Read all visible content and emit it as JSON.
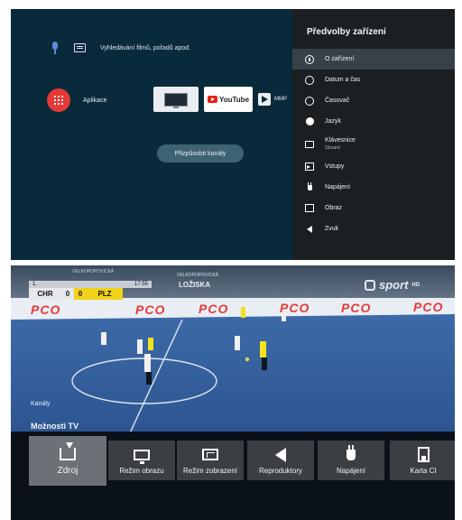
{
  "home": {
    "search_text": "Vyhledávání filmů, pořadů apod.",
    "apps_label": "Aplikace",
    "youtube_label": "YouTube",
    "mmp_label": "MMP",
    "customize_button": "Přizpůsobit kanály"
  },
  "device_prefs": {
    "title": "Předvolby zařízení",
    "items": [
      {
        "label": "O zařízení",
        "sub": "",
        "icon": "info-icon"
      },
      {
        "label": "Datum a čas",
        "sub": "",
        "icon": "clock-icon"
      },
      {
        "label": "Časovač",
        "sub": "",
        "icon": "timer-icon"
      },
      {
        "label": "Jazyk",
        "sub": "",
        "icon": "globe-icon"
      },
      {
        "label": "Klávesnice",
        "sub": "Gboard",
        "icon": "keyboard-icon"
      },
      {
        "label": "Vstupy",
        "sub": "",
        "icon": "input-icon"
      },
      {
        "label": "Napájení",
        "sub": "",
        "icon": "power-plug-icon"
      },
      {
        "label": "Obraz",
        "sub": "",
        "icon": "monitor-icon"
      },
      {
        "label": "Zvuk",
        "sub": "",
        "icon": "speaker-icon"
      }
    ]
  },
  "tv": {
    "scoreboard": {
      "period": "1.",
      "time": "17:55",
      "team1": "CHR",
      "score1": "0",
      "score2": "0",
      "team2": "PLZ"
    },
    "banner_small1": "VELKOPOPOVICKÁ",
    "banner_small2": "VELKOPOPOVICKÁ",
    "banner_main": "LOŽISKA",
    "channel_logo": "sport",
    "channel_hd": "HD",
    "ad_text": "PCO",
    "channels_label": "Kanály",
    "options_title": "Možnosti TV",
    "options": [
      {
        "label": "Zdroj",
        "icon": "source-icon"
      },
      {
        "label": "Režim obrazu",
        "icon": "monitor-icon"
      },
      {
        "label": "Režim zobrazení",
        "icon": "display-mode-icon"
      },
      {
        "label": "Reproduktory",
        "icon": "speaker-icon"
      },
      {
        "label": "Napájení",
        "icon": "power-plug-icon"
      },
      {
        "label": "Karta CI",
        "icon": "ci-card-icon"
      }
    ]
  },
  "colors": {
    "home_bg": "#082a3a",
    "panel_bg": "#1b1f22",
    "apps_red": "#e53935",
    "court_blue": "#2a5a9c",
    "score_yellow": "#f3d21a"
  }
}
